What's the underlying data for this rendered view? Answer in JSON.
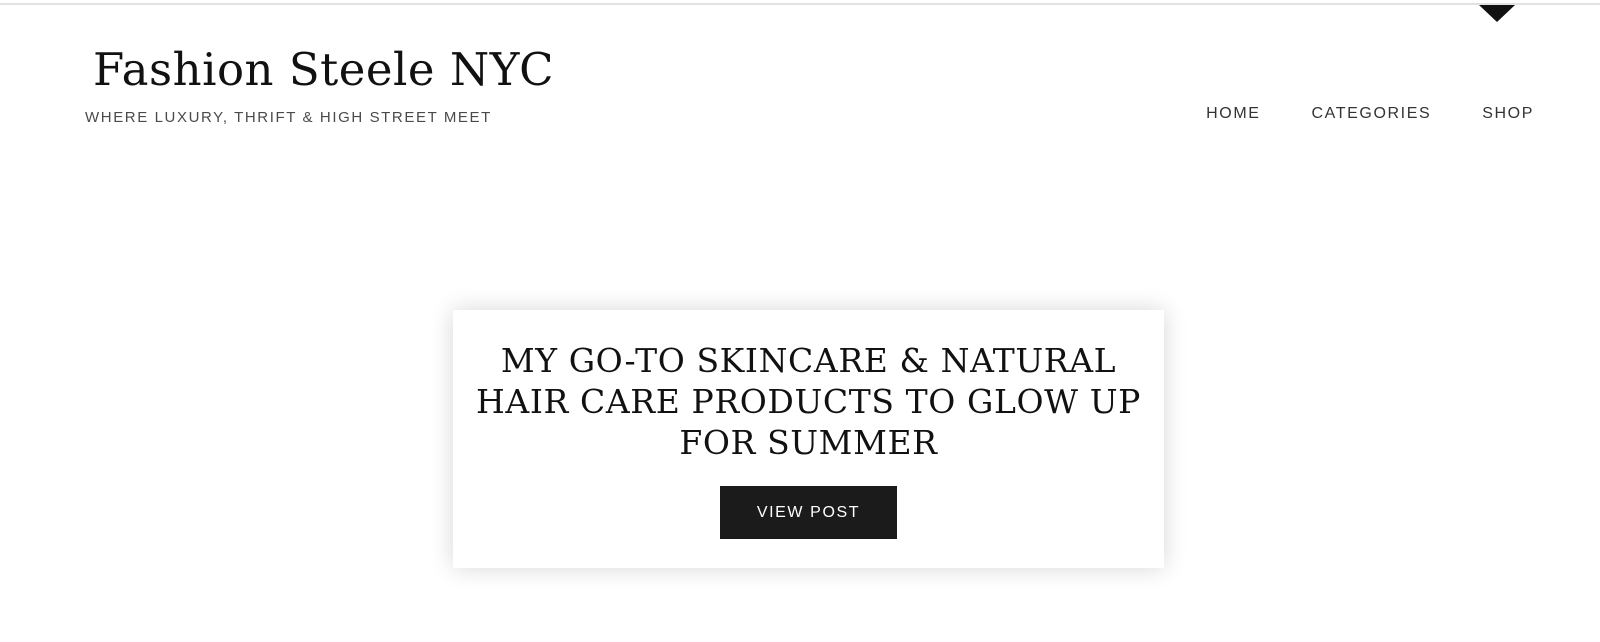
{
  "header": {
    "site_title": "Fashion Steele NYC",
    "tagline": "WHERE LUXURY, THRIFT & HIGH STREET MEET"
  },
  "nav": {
    "items": [
      {
        "label": "HOME"
      },
      {
        "label": "CATEGORIES"
      },
      {
        "label": "SHOP"
      }
    ]
  },
  "featured_post": {
    "title": "MY GO-TO SKINCARE & NATURAL HAIR CARE PRODUCTS TO GLOW UP FOR SUMMER",
    "button_label": "VIEW POST"
  },
  "icons": {
    "top_caret": "caret-down-icon"
  },
  "colors": {
    "text": "#111111",
    "button_bg": "#1b1b1b",
    "button_text": "#ffffff",
    "tagline": "#4a4a4a"
  }
}
